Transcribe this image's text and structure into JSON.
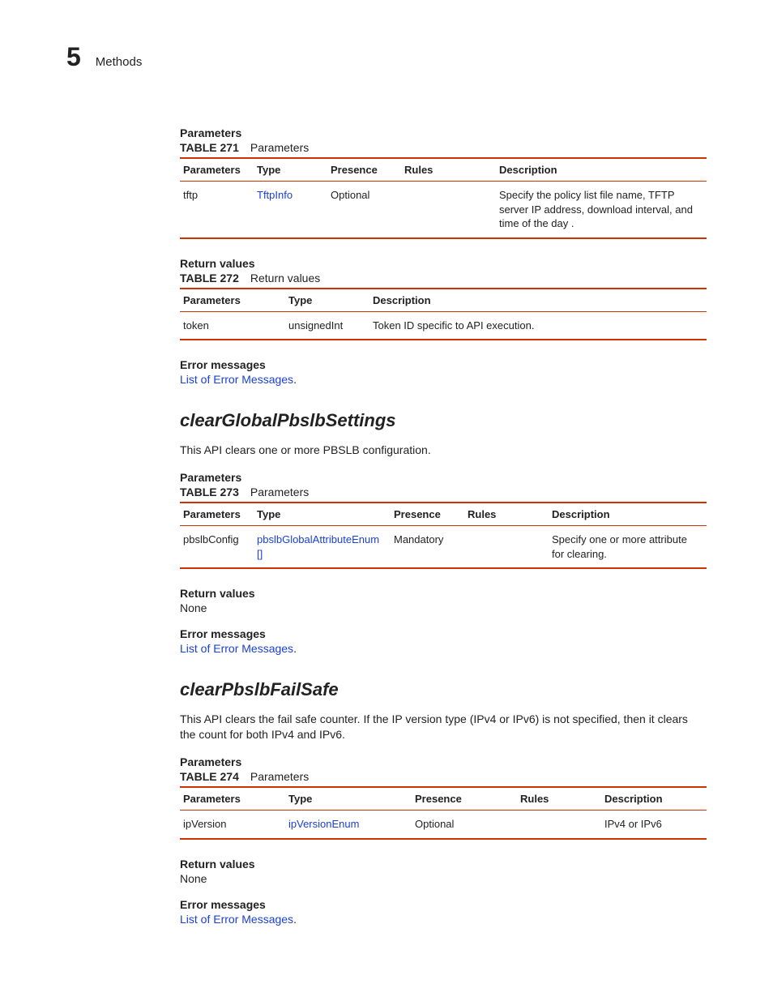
{
  "header": {
    "chapter_number": "5",
    "chapter_title": "Methods"
  },
  "section1": {
    "parameters_label": "Parameters",
    "table_label": "TABLE 271",
    "table_title": "Parameters",
    "columns": {
      "parameters": "Parameters",
      "type": "Type",
      "presence": "Presence",
      "rules": "Rules",
      "description": "Description"
    },
    "row": {
      "param": "tftp",
      "type": "TftpInfo",
      "presence": "Optional",
      "rules": "",
      "description": "Specify the policy list file name, TFTP  server IP address, download interval, and time of the day ."
    },
    "return_label": "Return values",
    "table2_label": "TABLE 272",
    "table2_title": "Return values",
    "columns2": {
      "parameters": "Parameters",
      "type": "Type",
      "description": "Description"
    },
    "row2": {
      "param": "token",
      "type": "unsignedInt",
      "description": "Token ID specific to API execution."
    },
    "error_label": "Error messages",
    "error_link": "List of Error Messages",
    "error_period": "."
  },
  "section2": {
    "heading": "clearGlobalPbslbSettings",
    "intro": "This API clears one or more PBSLB configuration.",
    "parameters_label": "Parameters",
    "table_label": "TABLE 273",
    "table_title": "Parameters",
    "columns": {
      "parameters": "Parameters",
      "type": "Type",
      "presence": "Presence",
      "rules": "Rules",
      "description": "Description"
    },
    "row": {
      "param": "pbslbConfig",
      "type": "pbslbGlobalAttributeEnum []",
      "presence": "Mandatory",
      "rules": "",
      "description": "Specify one or more attribute for clearing."
    },
    "return_label": "Return values",
    "return_value": "None",
    "error_label": "Error messages",
    "error_link": "List of Error Messages",
    "error_period": "."
  },
  "section3": {
    "heading": "clearPbslbFailSafe",
    "intro": "This API clears the fail safe counter.  If the IP version type (IPv4 or IPv6) is not specified, then it clears the count for both IPv4 and IPv6.",
    "parameters_label": "Parameters",
    "table_label": "TABLE 274",
    "table_title": "Parameters",
    "columns": {
      "parameters": "Parameters",
      "type": "Type",
      "presence": "Presence",
      "rules": "Rules",
      "description": "Description"
    },
    "row": {
      "param": "ipVersion",
      "type": "ipVersionEnum",
      "presence": "Optional",
      "rules": "",
      "description": "IPv4 or IPv6"
    },
    "return_label": "Return values",
    "return_value": "None",
    "error_label": "Error messages",
    "error_link": "List of Error Messages",
    "error_period": "."
  }
}
